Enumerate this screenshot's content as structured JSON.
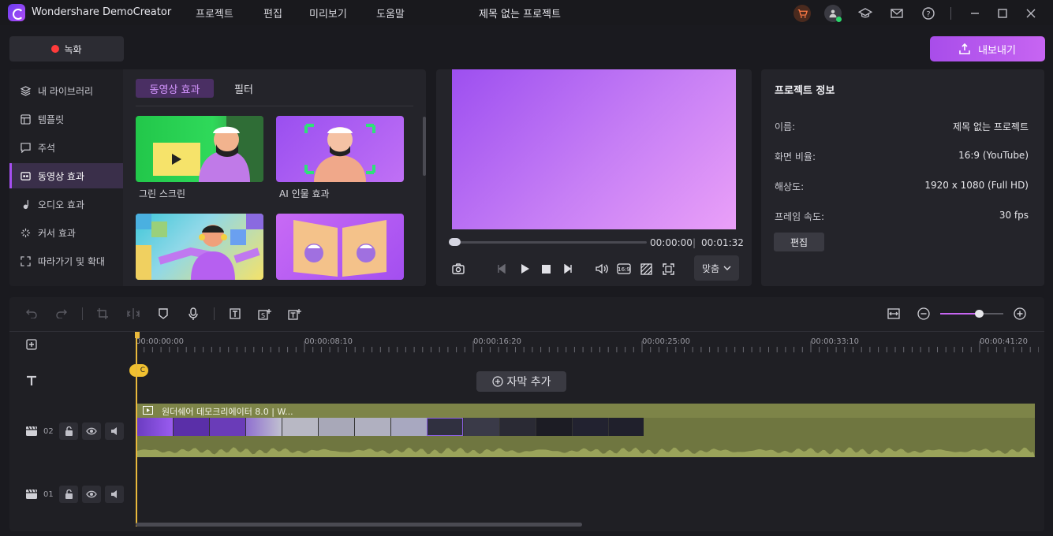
{
  "app": {
    "name": "Wondershare DemoCreator",
    "project_title": "제목 없는 프로젝트"
  },
  "menu": [
    "프로젝트",
    "편집",
    "미리보기",
    "도움말"
  ],
  "toolbar": {
    "record_label": "녹화",
    "export_label": "내보내기"
  },
  "sidebar": {
    "items": [
      {
        "label": "내 라이브러리",
        "icon": "layers-icon"
      },
      {
        "label": "템플릿",
        "icon": "template-icon"
      },
      {
        "label": "주석",
        "icon": "annotation-icon"
      },
      {
        "label": "동영상 효과",
        "icon": "video-effect-icon",
        "active": true
      },
      {
        "label": "오디오 효과",
        "icon": "music-note-icon"
      },
      {
        "label": "커서 효과",
        "icon": "cursor-effect-icon"
      },
      {
        "label": "따라가기 및 확대",
        "icon": "zoom-follow-icon"
      }
    ]
  },
  "library": {
    "tabs": [
      {
        "label": "동영상 효과",
        "active": true
      },
      {
        "label": "필터",
        "active": false
      }
    ],
    "effects": [
      {
        "label": "그린 스크린"
      },
      {
        "label": "AI 인물 효과"
      },
      {
        "label": ""
      },
      {
        "label": ""
      }
    ]
  },
  "player": {
    "current_time": "00:00:00",
    "total_time": "00:01:32",
    "fit_label": "맞춤",
    "progress": 0.0
  },
  "project_info": {
    "title": "프로젝트 정보",
    "rows": [
      {
        "label": "이름:",
        "value": "제목 없는 프로젝트"
      },
      {
        "label": "화면 비율:",
        "value": "16:9 (YouTube)"
      },
      {
        "label": "해상도:",
        "value": "1920 x 1080 (Full HD)"
      },
      {
        "label": "프레임 속도:",
        "value": "30 fps"
      }
    ],
    "edit_label": "편집"
  },
  "timeline": {
    "ruler": [
      "00:00:00:00",
      "00:00:08:10",
      "00:00:16:20",
      "00:00:25:00",
      "00:00:33:10",
      "00:00:41:20"
    ],
    "add_subtitle_label": "자막 추가",
    "clip_title": "원더쉐어 데모크리에이터 8.0 |  W...",
    "tracks": [
      {
        "number": "02"
      },
      {
        "number": "01"
      }
    ],
    "zoom_level": 0.61
  },
  "colors": {
    "accent": "#b25cf0",
    "playhead": "#e9b93c",
    "clip": "#6f7640"
  }
}
